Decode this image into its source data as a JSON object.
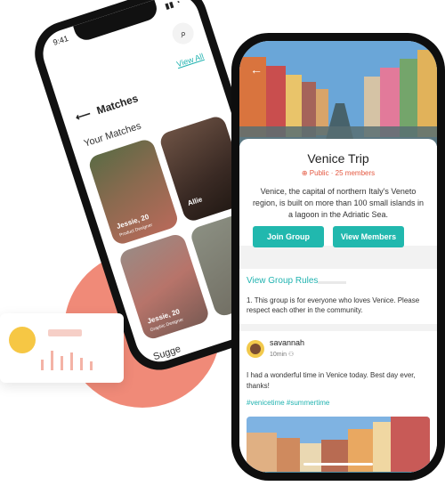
{
  "matches_screen": {
    "status_time": "9:41",
    "view_all": "View All",
    "title": "Matches",
    "section_title": "Your Matches",
    "cards": [
      {
        "name": "Jessie, 20",
        "role": "Product Designer"
      },
      {
        "name": "Allie",
        "role": ""
      },
      {
        "name": "Jessie, 20",
        "role": "Graphic Designer"
      }
    ],
    "suggestions_title": "Sugge"
  },
  "group_screen": {
    "title": "Venice Trip",
    "meta": "Public · 25 members",
    "description": "Venice, the capital of northern Italy's Veneto region, is built on more than 100 small islands in a lagoon in the Adriatic Sea.",
    "join_button": "Join Group",
    "view_members_button": "View Members",
    "rules_title": "View Group Rules",
    "rules_text": "1. This group is for everyone who loves Venice. Please respect each other in the community."
  },
  "post": {
    "username": "savannah",
    "time": "10min",
    "text": "I had a wonderful time in Venice today. Best day ever, thanks!",
    "tags": "#venicetime #summertime"
  },
  "colors": {
    "accent": "#21b8ae",
    "coral": "#f08a78",
    "meta_red": "#e4573f"
  }
}
